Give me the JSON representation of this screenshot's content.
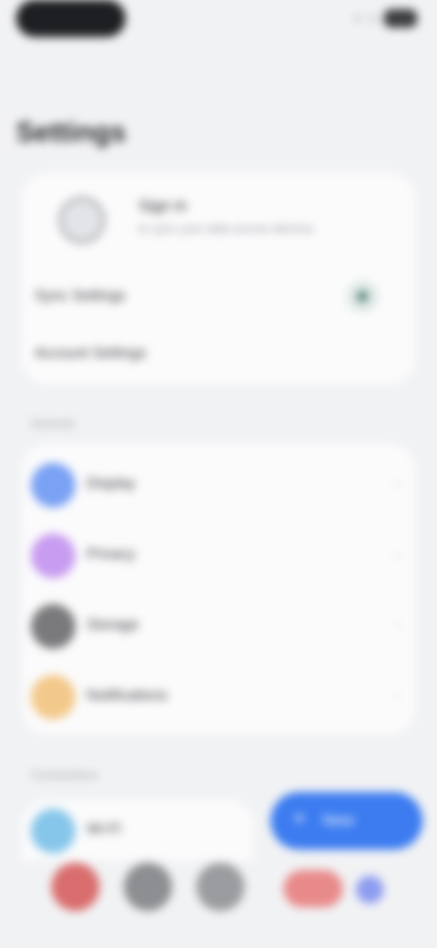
{
  "status_bar": {
    "time": "",
    "battery": ""
  },
  "page": {
    "title": "Settings"
  },
  "account": {
    "name": "Sign in",
    "subtitle": "to sync your data across devices",
    "sync_label": "Sync Settings",
    "manage_label": "Account Settings"
  },
  "section_general": {
    "label": "General"
  },
  "settings": [
    {
      "label": "Display",
      "icon": "display-icon",
      "color": "#7aa1f4"
    },
    {
      "label": "Privacy",
      "icon": "privacy-icon",
      "color": "#c89cf0"
    },
    {
      "label": "Storage",
      "icon": "storage-icon",
      "color": "#7a7a7c"
    },
    {
      "label": "Notifications",
      "icon": "notifications-icon",
      "color": "#f3c98b"
    }
  ],
  "section_connections": {
    "label": "Connections"
  },
  "connections": [
    {
      "label": "Wi-Fi",
      "icon": "wifi-icon",
      "color": "#86c6ea"
    }
  ],
  "fab": {
    "icon": "+",
    "label": "New"
  },
  "dock": [
    {
      "label": "",
      "icon": "gallery-icon",
      "color": "#d96d6d"
    },
    {
      "label": "",
      "icon": "camera-icon",
      "color": "#8d8e91"
    },
    {
      "label": "",
      "icon": "settings-icon",
      "color": "#9b9c9f"
    },
    {
      "label": "",
      "icon": "messages-icon",
      "color": "#e98a8a"
    },
    {
      "label": "",
      "icon": "phone-icon",
      "color": "#8d9cf0"
    }
  ]
}
